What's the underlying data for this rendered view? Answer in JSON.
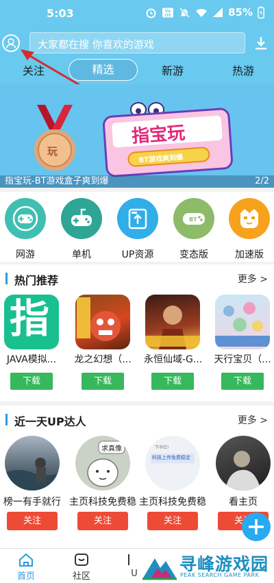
{
  "status": {
    "time": "5:03",
    "battery": "85%"
  },
  "search": {
    "placeholder": "大家都在搜  你喜欢的游戏"
  },
  "tabs": [
    {
      "label": "关注"
    },
    {
      "label": "精选"
    },
    {
      "label": "新游"
    },
    {
      "label": "热游"
    }
  ],
  "banner": {
    "logo_text": "指宝玩",
    "logo_sub": "BT游戏爽到爆",
    "medal_text": "玩",
    "caption": "指宝玩-BT游戏盒子爽到爆",
    "page": "2/2"
  },
  "categories": [
    {
      "label": "网游",
      "color": "#3fbfb2",
      "icon": "gamepad-icon"
    },
    {
      "label": "单机",
      "color": "#2fa595",
      "icon": "joystick-icon"
    },
    {
      "label": "UP资源",
      "color": "#2faee8",
      "icon": "upload-icon"
    },
    {
      "label": "变态版",
      "color": "#8dbb6a",
      "icon": "bt-gamepad-icon"
    },
    {
      "label": "加速版",
      "color": "#f6a21c",
      "icon": "cat-face-icon"
    }
  ],
  "hot": {
    "title": "热门推荐",
    "more": "更多 >",
    "download_label": "下载",
    "games": [
      {
        "name": "JAVA模拟...",
        "thumb_text": "指"
      },
      {
        "name": "龙之幻想（..."
      },
      {
        "name": "永恒仙域-G..."
      },
      {
        "name": "天行宝贝（..."
      }
    ]
  },
  "up": {
    "title": "近一天UP达人",
    "more": "更多 >",
    "follow_label": "关注",
    "users": [
      {
        "name": "榜一有手就行"
      },
      {
        "name": "主页科技免费稳",
        "bubble": "求真像"
      },
      {
        "name": "主页科技免费稳",
        "card_text": "科技上传免费稳定",
        "card_top": "下半红!"
      },
      {
        "name": "看主页"
      }
    ]
  },
  "nav": [
    {
      "label": "首页",
      "active": true
    },
    {
      "label": "社区",
      "active": false
    },
    {
      "label": "U",
      "active": false
    }
  ],
  "watermark": {
    "text": "寻峰游戏园",
    "sub": "PEAK SEARCH GAME PARK"
  },
  "colors": {
    "header": "#69c9ee",
    "accent": "#2a9be0",
    "download_green": "#36b85c",
    "follow_red": "#ee4b36"
  }
}
